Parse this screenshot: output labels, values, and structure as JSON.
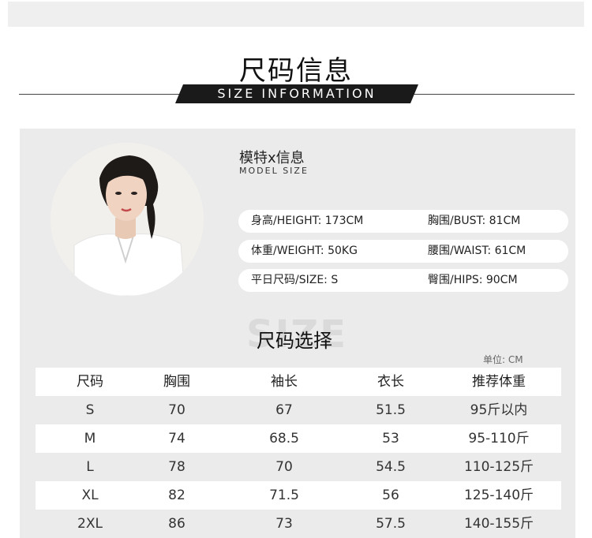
{
  "header": {
    "title": "尺码信息",
    "banner": "SIZE INFORMATION"
  },
  "model": {
    "title": "模特x信息",
    "subtitle": "MODEL SIZE",
    "rows": [
      {
        "left": "身高/HEIGHT:  173CM",
        "right": "胸围/BUST:  81CM"
      },
      {
        "left": "体重/WEIGHT:  50KG",
        "right": "腰围/WAIST:  61CM"
      },
      {
        "left": "平日尺码/SIZE:    S",
        "right": "臀围/HIPS:  90CM"
      }
    ]
  },
  "size_section": {
    "watermark": "SIZE",
    "title": "尺码选择",
    "unit": "单位: CM"
  },
  "table": {
    "headers": [
      "尺码",
      "胸围",
      "袖长",
      "衣长",
      "推荐体重"
    ],
    "rows": [
      [
        "S",
        "70",
        "67",
        "51.5",
        "95斤以内"
      ],
      [
        "M",
        "74",
        "68.5",
        "53",
        "95-110斤"
      ],
      [
        "L",
        "78",
        "70",
        "54.5",
        "110-125斤"
      ],
      [
        "XL",
        "82",
        "71.5",
        "56",
        "125-140斤"
      ],
      [
        "2XL",
        "86",
        "73",
        "57.5",
        "140-155斤"
      ]
    ]
  }
}
